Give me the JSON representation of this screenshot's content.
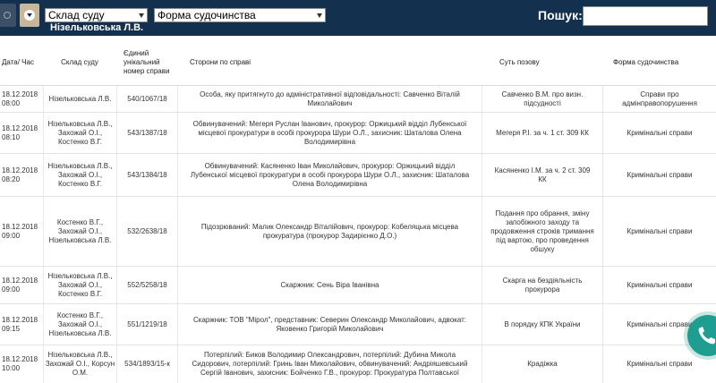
{
  "toolbar": {
    "court_select": "Склад суду",
    "form_select": "Форма судочинства",
    "judge_name": "Нізельковська Л.В.",
    "search_label": "Пошук:",
    "search_value": ""
  },
  "table": {
    "headers": [
      "Дата/ Час",
      "Склад суду",
      "Єдиний унікальний номер справи",
      "Сторони по справі",
      "Суть позову",
      "Форма судочинства"
    ],
    "rows": [
      {
        "date": "18.12.2018 08:00",
        "court": "Нізельковська Л.В.",
        "case_no": "540/1067/18",
        "parties": "Особа, яку притягнуто до адміністративної відповідальності: Савченко Віталій Миколайович",
        "essence": "Савченко В.М. про визн. підсудності",
        "form": "Справи про адмінправопорушення"
      },
      {
        "date": "18.12.2018 08:10",
        "court": "Нізельковська Л.В., Захожай О.І., Костенко В.Г.",
        "case_no": "543/1387/18",
        "parties": "Обвинувачений: Мегеря Руслан Іванович, прокурор: Оржицький відділ Лубенської місцевої прокуратури в особі прокурора Шури О.Л., захисник: Шаталова Олена Володимирівна",
        "essence": "Мегеря Р.І. за ч. 1 ст. 309 КК",
        "form": "Кримінальні справи"
      },
      {
        "date": "18.12.2018 08:20",
        "court": "Нізельковська Л.В., Захожай О.І., Костенко В.Г.",
        "case_no": "543/1384/18",
        "parties": "Обвинувачений: Касяненко Іван Миколайович, прокурор: Оржицький відділ Лубенської місцевої прокуратури в особі прокурора Шури О.Л., захисник: Шаталова Олена Володимирівна",
        "essence": "Касяненко І.М. за ч. 2 ст. 309 КК",
        "form": "Кримінальні справи"
      },
      {
        "date": "18.12.2018 09:00",
        "court": "Костенко В.Г., Захожай О.І., Нізельковська Л.В.",
        "case_no": "532/2638/18",
        "parties": "Підозрюваний: Малик Олександр Віталійович, прокурор: Кобеляцька місцева прокуратура (прокурор Задирієнко Д.О.)",
        "essence": "Подання про обрання, зміну запобіжного заходу та продовження строків тримання під вартою, про проведення обшуку",
        "form": "Кримінальні справи"
      },
      {
        "date": "18.12.2018 09:00",
        "court": "Нізельковська Л.В., Захожай О.І., Костенко В.Г.",
        "case_no": "552/5258/18",
        "parties": "Скаржник: Сень Віра Іванівна",
        "essence": "Скарга на бездіяльність прокурора",
        "form": "Кримінальні справи"
      },
      {
        "date": "18.12.2018 09:15",
        "court": "Костенко В.Г., Захожай О.І., Нізельковська Л.В.",
        "case_no": "551/1219/18",
        "parties": "Скаржник: ТОВ \"Мірол\", представник: Северин Олександр Миколайович, адвокат: Яковенко Григорій Миколайович",
        "essence": "В порядку КПК України",
        "form": "Кримінальні справи"
      },
      {
        "date": "18.12.2018 10:00",
        "court": "Нізельковська Л.В., Захожай О.І., Корсун О.М.",
        "case_no": "534/1893/15-к",
        "parties": "Потерпілий: Биков Володимир Олександрович, потерпілий: Дубина Микола Сидорович, потерпілий: Гринь Іван Миколайович, обвинувачений: Андріяшевський Сергій Іванович, захисник: Бойченко Г.В., прокурор: Прокуратура Полтавської",
        "essence": "Крадіжка",
        "form": "Кримінальні справи"
      }
    ]
  }
}
